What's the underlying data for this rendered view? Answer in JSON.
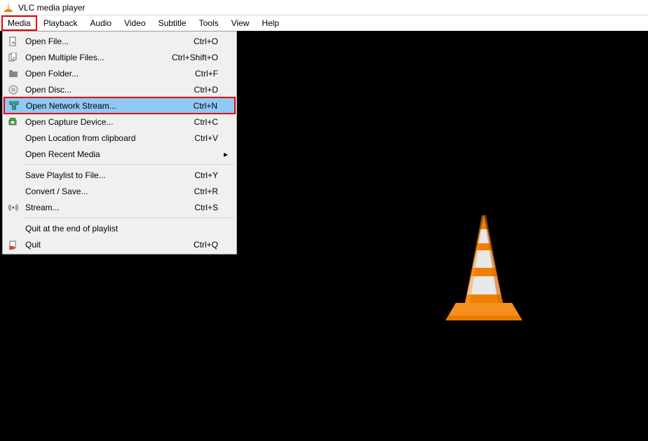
{
  "title": "VLC media player",
  "menubar": [
    "Media",
    "Playback",
    "Audio",
    "Video",
    "Subtitle",
    "Tools",
    "View",
    "Help"
  ],
  "activeMenu": "Media",
  "dropdown": {
    "items": [
      {
        "icon": "file",
        "label": "Open File...",
        "shortcut": "Ctrl+O"
      },
      {
        "icon": "files",
        "label": "Open Multiple Files...",
        "shortcut": "Ctrl+Shift+O"
      },
      {
        "icon": "folder",
        "label": "Open Folder...",
        "shortcut": "Ctrl+F"
      },
      {
        "icon": "disc",
        "label": "Open Disc...",
        "shortcut": "Ctrl+D"
      },
      {
        "icon": "network",
        "label": "Open Network Stream...",
        "shortcut": "Ctrl+N",
        "highlighted": true
      },
      {
        "icon": "capture",
        "label": "Open Capture Device...",
        "shortcut": "Ctrl+C"
      },
      {
        "icon": "",
        "label": "Open Location from clipboard",
        "shortcut": "Ctrl+V"
      },
      {
        "icon": "",
        "label": "Open Recent Media",
        "shortcut": "",
        "submenu": true
      },
      {
        "separator": true
      },
      {
        "icon": "",
        "label": "Save Playlist to File...",
        "shortcut": "Ctrl+Y"
      },
      {
        "icon": "",
        "label": "Convert / Save...",
        "shortcut": "Ctrl+R"
      },
      {
        "icon": "stream",
        "label": "Stream...",
        "shortcut": "Ctrl+S"
      },
      {
        "separator": true
      },
      {
        "icon": "",
        "label": "Quit at the end of playlist",
        "shortcut": ""
      },
      {
        "icon": "quit",
        "label": "Quit",
        "shortcut": "Ctrl+Q"
      }
    ]
  }
}
